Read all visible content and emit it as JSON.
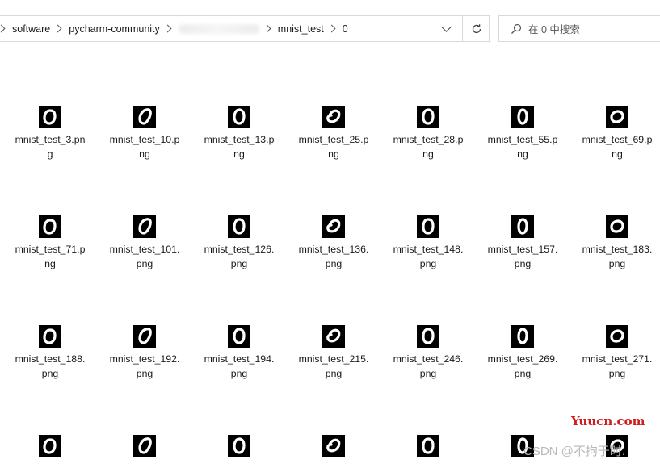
{
  "breadcrumb": {
    "items": [
      "software",
      "pycharm-community",
      "",
      "mnist_test",
      "0"
    ]
  },
  "search": {
    "placeholder": "在 0 中搜索"
  },
  "files": [
    {
      "line1": "mnist_test_3.pn",
      "line2": "g"
    },
    {
      "line1": "mnist_test_10.p",
      "line2": "ng"
    },
    {
      "line1": "mnist_test_13.p",
      "line2": "ng"
    },
    {
      "line1": "mnist_test_25.p",
      "line2": "ng"
    },
    {
      "line1": "mnist_test_28.p",
      "line2": "ng"
    },
    {
      "line1": "mnist_test_55.p",
      "line2": "ng"
    },
    {
      "line1": "mnist_test_69.p",
      "line2": "ng"
    },
    {
      "line1": "mnist_test_71.p",
      "line2": "ng"
    },
    {
      "line1": "mnist_test_101.",
      "line2": "png"
    },
    {
      "line1": "mnist_test_126.",
      "line2": "png"
    },
    {
      "line1": "mnist_test_136.",
      "line2": "png"
    },
    {
      "line1": "mnist_test_148.",
      "line2": "png"
    },
    {
      "line1": "mnist_test_157.",
      "line2": "png"
    },
    {
      "line1": "mnist_test_183.",
      "line2": "png"
    },
    {
      "line1": "mnist_test_188.",
      "line2": "png"
    },
    {
      "line1": "mnist_test_192.",
      "line2": "png"
    },
    {
      "line1": "mnist_test_194.",
      "line2": "png"
    },
    {
      "line1": "mnist_test_215.",
      "line2": "png"
    },
    {
      "line1": "mnist_test_246.",
      "line2": "png"
    },
    {
      "line1": "mnist_test_269.",
      "line2": "png"
    },
    {
      "line1": "mnist_test_271.",
      "line2": "png"
    },
    {
      "line1": "",
      "line2": ""
    },
    {
      "line1": "",
      "line2": ""
    },
    {
      "line1": "",
      "line2": ""
    },
    {
      "line1": "",
      "line2": ""
    },
    {
      "line1": "",
      "line2": ""
    },
    {
      "line1": "",
      "line2": ""
    },
    {
      "line1": "",
      "line2": ""
    }
  ],
  "watermarks": {
    "site": "Yuucn.com",
    "csdn": "CSDN @不拘于时."
  }
}
